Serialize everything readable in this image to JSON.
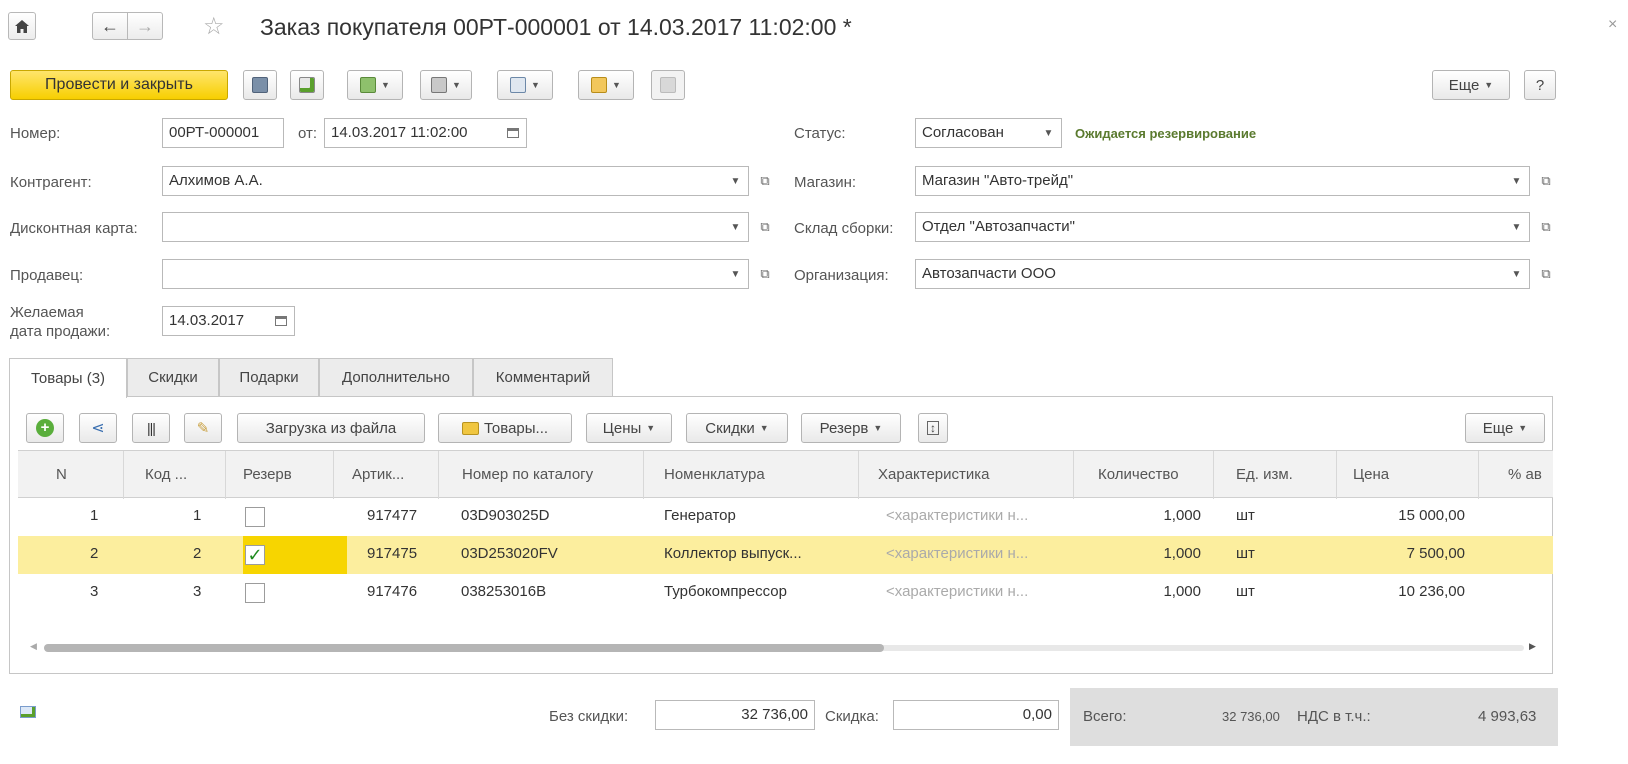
{
  "header": {
    "home_icon": "home-icon",
    "back_icon": "arrow-left-icon",
    "forward_icon": "arrow-right-icon",
    "star_icon": "star-icon",
    "title": "Заказ покупателя 00РТ-000001 от 14.03.2017 11:02:00 *",
    "close": "×"
  },
  "toolbar": {
    "post_close": "Провести и закрыть",
    "more": "Еще",
    "help": "?"
  },
  "form": {
    "number_label": "Номер:",
    "number_value": "00РТ-000001",
    "from_label": "от:",
    "date_value": "14.03.2017 11:02:00",
    "status_label": "Статус:",
    "status_value": "Согласован",
    "status_note": "Ожидается резервирование",
    "counterparty_label": "Контрагент:",
    "counterparty_value": "Алхимов А.А.",
    "store_label": "Магазин:",
    "store_value": "Магазин \"Авто-трейд\"",
    "discount_card_label": "Дисконтная карта:",
    "discount_card_value": "",
    "warehouse_label": "Склад сборки:",
    "warehouse_value": "Отдел \"Автозапчасти\"",
    "seller_label": "Продавец:",
    "seller_value": "",
    "organization_label": "Организация:",
    "organization_value": "Автозапчасти ООО",
    "desired_date_label_1": "Желаемая",
    "desired_date_label_2": "дата продажи:",
    "desired_date_value": "14.03.2017"
  },
  "tabs": [
    {
      "label": "Товары (3)"
    },
    {
      "label": "Скидки"
    },
    {
      "label": "Подарки"
    },
    {
      "label": "Дополнительно"
    },
    {
      "label": "Комментарий"
    }
  ],
  "table_toolbar": {
    "load_from_file": "Загрузка из файла",
    "goods": "Товары...",
    "prices": "Цены",
    "discounts": "Скидки",
    "reserve": "Резерв",
    "more": "Еще"
  },
  "table": {
    "columns": [
      "N",
      "Код ...",
      "Резерв",
      "Артик...",
      "Номер по каталогу",
      "Номенклатура",
      "Характеристика",
      "Количество",
      "Ед. изм.",
      "Цена",
      "% ав"
    ],
    "rows": [
      {
        "n": "1",
        "code": "1",
        "reserve": false,
        "article": "917477",
        "catalog": "03D903025D",
        "name": "Генератор",
        "char": "<характеристики н...",
        "qty": "1,000",
        "unit": "шт",
        "price": "15 000,00"
      },
      {
        "n": "2",
        "code": "2",
        "reserve": true,
        "article": "917475",
        "catalog": "03D253020FV",
        "name": "Коллектор выпуск...",
        "char": "<характеристики н...",
        "qty": "1,000",
        "unit": "шт",
        "price": "7 500,00"
      },
      {
        "n": "3",
        "code": "3",
        "reserve": false,
        "article": "917476",
        "catalog": "038253016B",
        "name": "Турбокомпрессор",
        "char": "<характеристики н...",
        "qty": "1,000",
        "unit": "шт",
        "price": "10 236,00"
      }
    ]
  },
  "footer": {
    "without_discount_label": "Без скидки:",
    "without_discount_value": "32 736,00",
    "discount_label": "Скидка:",
    "discount_value": "0,00",
    "total_label": "Всего:",
    "total_value": "32 736,00",
    "vat_label": "НДС в т.ч.:",
    "vat_value": "4 993,63"
  },
  "colors": {
    "primary": "#f7cf00",
    "selected_row": "#fcee9e",
    "status_note": "#5a7a2e"
  }
}
